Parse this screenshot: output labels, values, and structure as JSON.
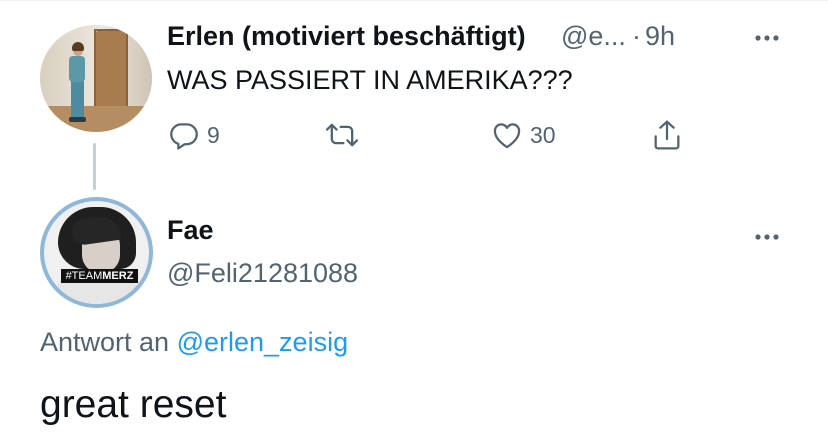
{
  "parent_tweet": {
    "author_name": "Erlen (motiviert beschäftigt)",
    "handle_truncated": "@e...",
    "separator": "·",
    "time": "9h",
    "text": "WAS PASSIERT IN AMERIKA???",
    "reply_count": "9",
    "retweet_count": "",
    "like_count": "30"
  },
  "main_tweet": {
    "author_name": "Fae",
    "handle": "@Feli21281088",
    "avatar_badge_prefix": "#TEAM",
    "avatar_badge_bold": "MERZ",
    "reply_to_prefix": "Antwort an",
    "reply_to_handle": "@erlen_zeisig",
    "text": "great reset"
  },
  "icons": {
    "more": "more-horizontal-icon",
    "reply": "reply-icon",
    "retweet": "retweet-icon",
    "like": "heart-icon",
    "share": "share-icon"
  },
  "colors": {
    "text_primary": "#0f1419",
    "text_secondary": "#536471",
    "link": "#1d9bf0",
    "thread_line": "#c4cfd6",
    "avatar_ring": "#8fb7d8"
  }
}
